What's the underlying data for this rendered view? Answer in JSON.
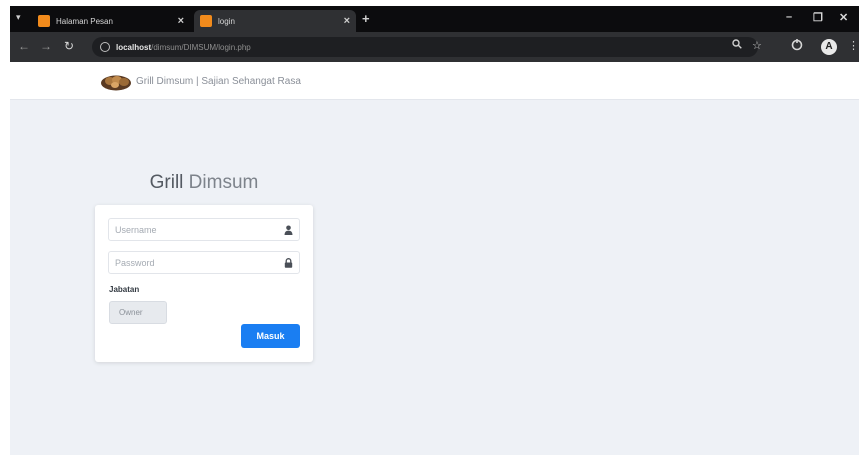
{
  "browser": {
    "tabs": [
      {
        "title": "Halaman Pesan",
        "active": false
      },
      {
        "title": "login",
        "active": true
      }
    ],
    "new_tab": "+",
    "controls": {
      "minimize": "–",
      "maximize": "❐",
      "close": "✕"
    },
    "url_host": "localhost",
    "url_path": "/dimsum/DIMSUM/login.php",
    "nav_icons": {
      "back": "←",
      "forward": "→",
      "reload": "↻"
    },
    "toolbar_icons": [
      "search-icon",
      "star-icon",
      "extension-icon"
    ],
    "profile_initial": "A"
  },
  "navbar": {
    "brand": "Grill Dimsum | Sajian Sehangat Rasa"
  },
  "login": {
    "title_part1": "Grill",
    "title_part2": " Dimsum",
    "username_placeholder": "Username",
    "password_placeholder": "Password",
    "role_label": "Jabatan",
    "role_value": "Owner",
    "submit_label": "Masuk"
  },
  "colors": {
    "accent": "#1a7ef2",
    "page_bg": "#eef1f6",
    "tab_favicon": "#f28b1c"
  }
}
